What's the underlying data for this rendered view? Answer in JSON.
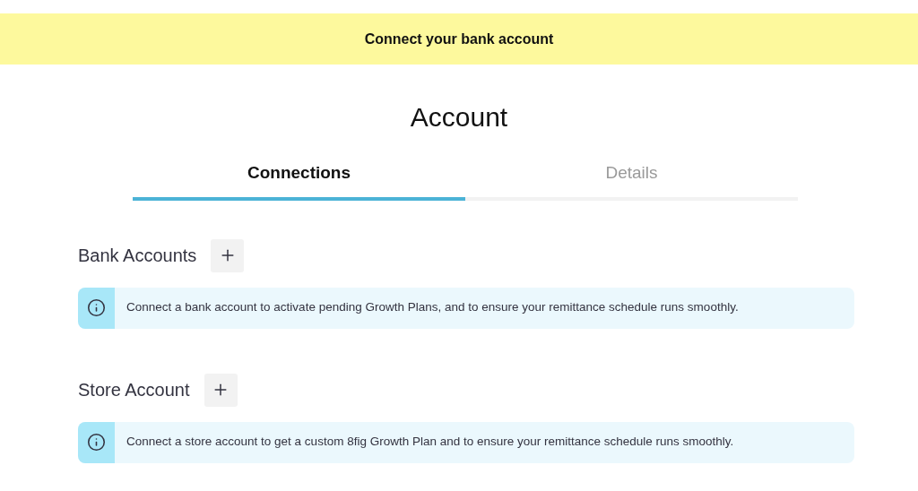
{
  "banner": {
    "text": "Connect your bank account"
  },
  "title": "Account",
  "tabs": [
    {
      "label": "Connections",
      "selected": true
    },
    {
      "label": "Details",
      "selected": false
    }
  ],
  "sections": [
    {
      "heading": "Bank Accounts",
      "info": "Connect a bank account to activate pending Growth Plans, and to ensure your remittance schedule runs smoothly."
    },
    {
      "heading": "Store Account",
      "info": "Connect a store account to get a custom 8fig Growth Plan and to ensure your remittance schedule runs smoothly."
    }
  ]
}
